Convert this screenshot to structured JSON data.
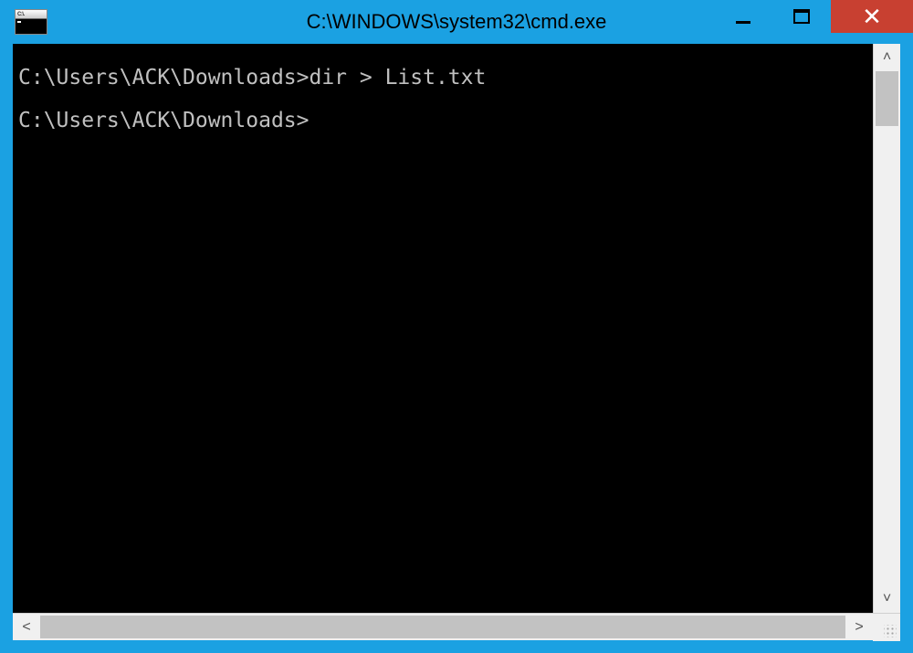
{
  "window": {
    "title": "C:\\WINDOWS\\system32\\cmd.exe",
    "icon_label": "C:\\."
  },
  "terminal": {
    "lines": [
      "C:\\Users\\ACK\\Downloads>dir > List.txt",
      "",
      "C:\\Users\\ACK\\Downloads>"
    ],
    "line0": "C:\\Users\\ACK\\Downloads>dir > List.txt",
    "line1": "C:\\Users\\ACK\\Downloads>"
  },
  "scroll": {
    "up": "˄",
    "down": "˅",
    "left": "˂",
    "right": "˃"
  }
}
